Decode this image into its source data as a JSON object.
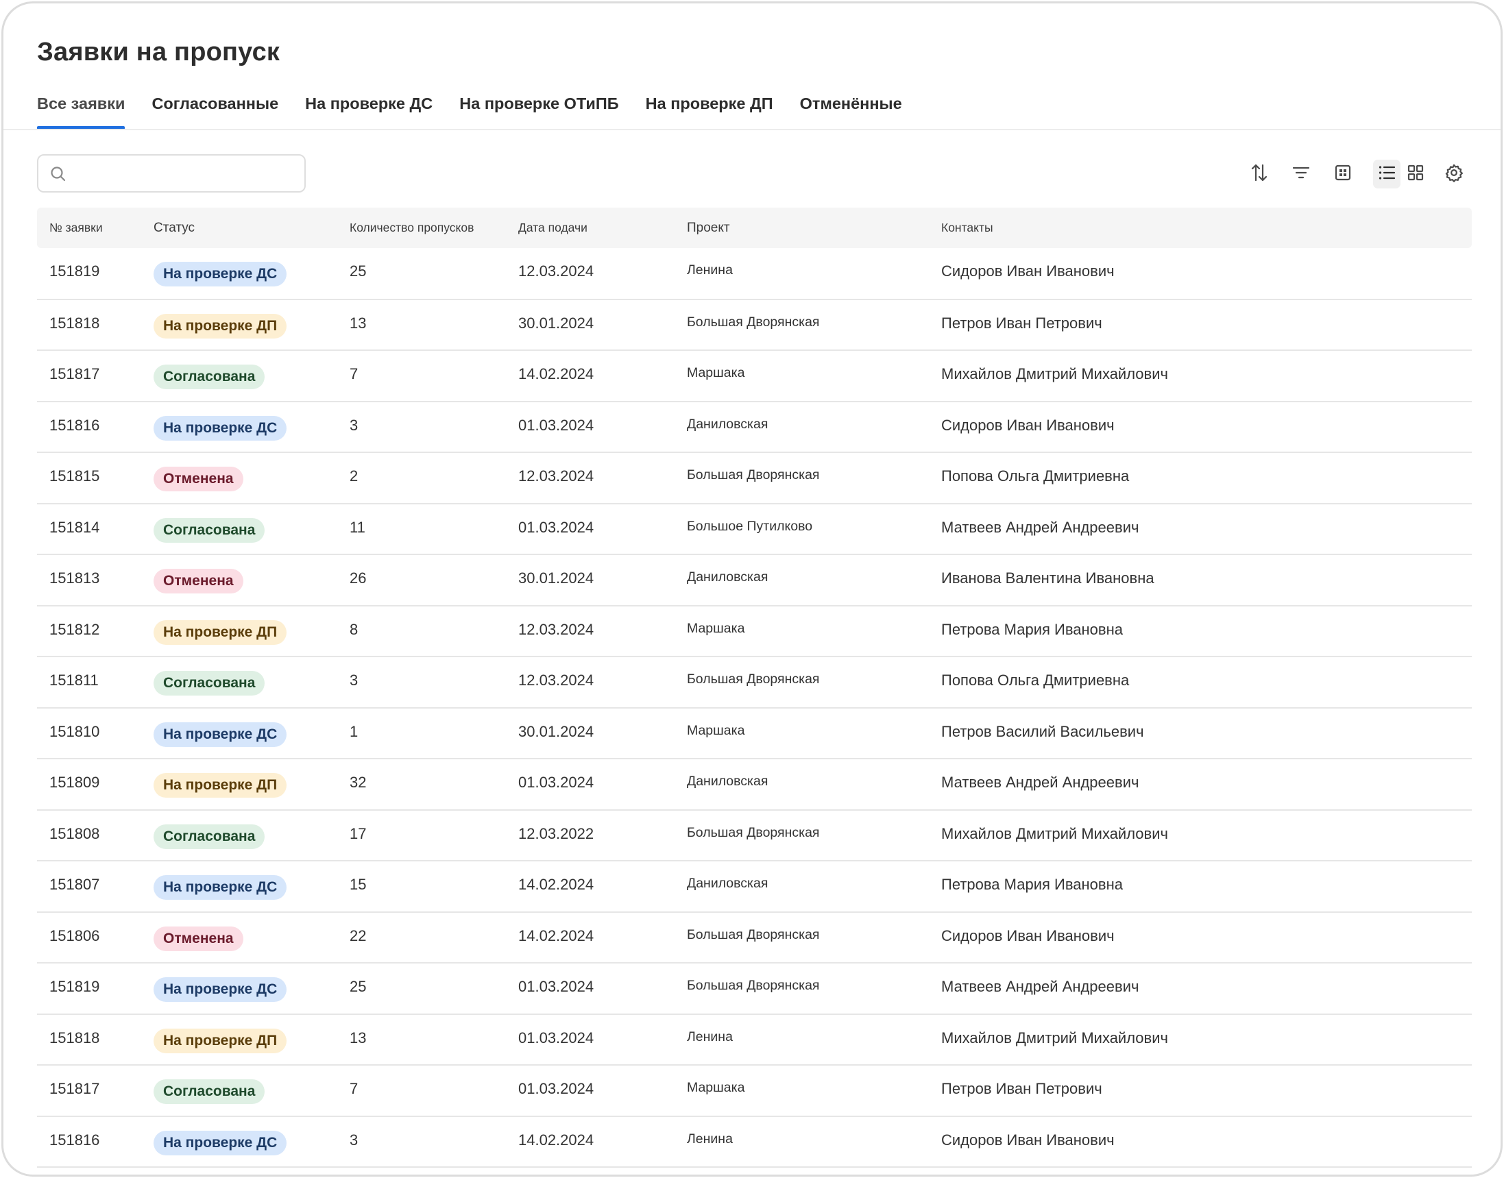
{
  "page": {
    "title": "Заявки на пропуск"
  },
  "tabs": [
    {
      "label": "Все заявки",
      "active": true
    },
    {
      "label": "Согласованные",
      "active": false
    },
    {
      "label": "На проверке ДС",
      "active": false
    },
    {
      "label": "На проверке ОТиПБ",
      "active": false
    },
    {
      "label": "На проверке ДП",
      "active": false
    },
    {
      "label": "Отменённые",
      "active": false
    }
  ],
  "search": {
    "value": "",
    "placeholder": "",
    "icon": "search-icon"
  },
  "toolbar": {
    "icons": [
      "sort-icon",
      "filter-icon",
      "columns-icon",
      "list-view-icon",
      "grid-view-icon",
      "settings-icon"
    ],
    "active_view": "list"
  },
  "table": {
    "columns": [
      "№ заявки",
      "Статус",
      "Количество пропусков",
      "Дата подачи",
      "Проект",
      "Контакты"
    ],
    "status_styles": {
      "На проверке ДС": {
        "bg": "#d6e6fb",
        "fg": "#1d3b66"
      },
      "На проверке ДП": {
        "bg": "#fdefd2",
        "fg": "#5a3d0a"
      },
      "Согласована": {
        "bg": "#dff0e4",
        "fg": "#1f4a2c"
      },
      "Отменена": {
        "bg": "#fbdde4",
        "fg": "#6b1b2c"
      }
    },
    "rows": [
      {
        "id": "151819",
        "status": "На проверке ДС",
        "count": "25",
        "date": "12.03.2024",
        "project": "Ленина",
        "contact": "Сидоров Иван Иванович"
      },
      {
        "id": "151818",
        "status": "На проверке ДП",
        "count": "13",
        "date": "30.01.2024",
        "project": "Большая Дворянская",
        "contact": "Петров Иван Петрович"
      },
      {
        "id": "151817",
        "status": "Согласована",
        "count": "7",
        "date": "14.02.2024",
        "project": "Маршака",
        "contact": "Михайлов Дмитрий Михайлович"
      },
      {
        "id": "151816",
        "status": "На проверке ДС",
        "count": "3",
        "date": "01.03.2024",
        "project": "Даниловская",
        "contact": "Сидоров Иван Иванович"
      },
      {
        "id": "151815",
        "status": "Отменена",
        "count": "2",
        "date": "12.03.2024",
        "project": "Большая Дворянская",
        "contact": "Попова Ольга Дмитриевна"
      },
      {
        "id": "151814",
        "status": "Согласована",
        "count": "11",
        "date": "01.03.2024",
        "project": "Большое Путилково",
        "contact": "Матвеев Андрей Андреевич"
      },
      {
        "id": "151813",
        "status": "Отменена",
        "count": "26",
        "date": "30.01.2024",
        "project": "Даниловская",
        "contact": "Иванова Валентина Ивановна"
      },
      {
        "id": "151812",
        "status": "На проверке ДП",
        "count": "8",
        "date": "12.03.2024",
        "project": "Маршака",
        "contact": "Петрова Мария Ивановна"
      },
      {
        "id": "151811",
        "status": "Согласована",
        "count": "3",
        "date": "12.03.2024",
        "project": "Большая Дворянская",
        "contact": "Попова Ольга Дмитриевна"
      },
      {
        "id": "151810",
        "status": "На проверке ДС",
        "count": "1",
        "date": "30.01.2024",
        "project": "Маршака",
        "contact": "Петров Василий Васильевич"
      },
      {
        "id": "151809",
        "status": "На проверке ДП",
        "count": "32",
        "date": "01.03.2024",
        "project": "Даниловская",
        "contact": "Матвеев Андрей Андреевич"
      },
      {
        "id": "151808",
        "status": "Согласована",
        "count": "17",
        "date": "12.03.2022",
        "project": "Большая Дворянская",
        "contact": "Михайлов Дмитрий Михайлович"
      },
      {
        "id": "151807",
        "status": "На проверке ДС",
        "count": "15",
        "date": "14.02.2024",
        "project": "Даниловская",
        "contact": "Петрова Мария Ивановна"
      },
      {
        "id": "151806",
        "status": "Отменена",
        "count": "22",
        "date": "14.02.2024",
        "project": "Большая Дворянская",
        "contact": "Сидоров Иван Иванович"
      },
      {
        "id": "151819",
        "status": "На проверке ДС",
        "count": "25",
        "date": "01.03.2024",
        "project": "Большая Дворянская",
        "contact": "Матвеев Андрей Андреевич"
      },
      {
        "id": "151818",
        "status": "На проверке ДП",
        "count": "13",
        "date": "01.03.2024",
        "project": "Ленина",
        "contact": "Михайлов Дмитрий Михайлович"
      },
      {
        "id": "151817",
        "status": "Согласована",
        "count": "7",
        "date": "01.03.2024",
        "project": "Маршака",
        "contact": "Петров Иван Петрович"
      },
      {
        "id": "151816",
        "status": "На проверке ДС",
        "count": "3",
        "date": "14.02.2024",
        "project": "Ленина",
        "contact": "Сидоров Иван Иванович"
      }
    ]
  },
  "colors": {
    "accent": "#1f6fe0",
    "header_bg": "#f5f5f5",
    "border": "#e6e6e6"
  }
}
